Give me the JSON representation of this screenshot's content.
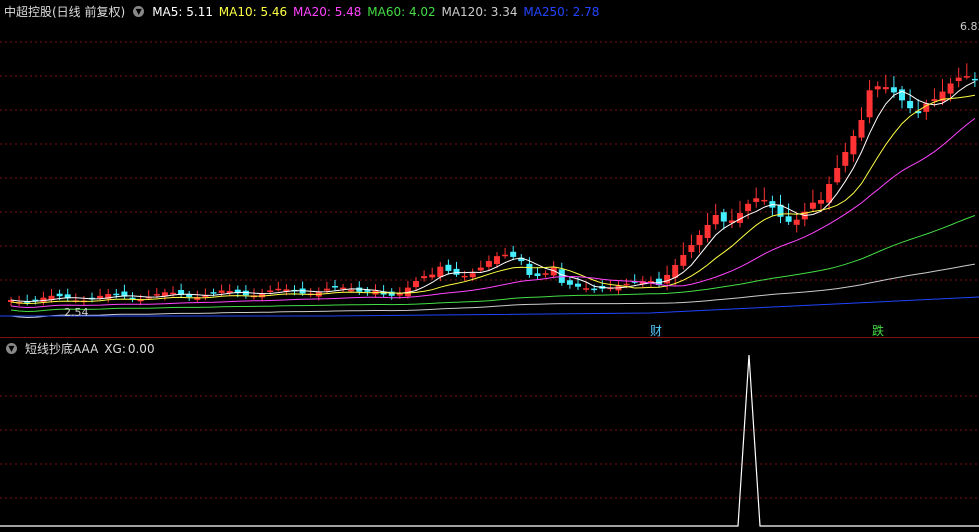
{
  "main": {
    "title": "中超控股(日线 前复权)",
    "ma": [
      {
        "label": "MA5:",
        "value": "5.11",
        "color": "#ffffff"
      },
      {
        "label": "MA10:",
        "value": "5.46",
        "color": "#ffff44"
      },
      {
        "label": "MA20:",
        "value": "5.48",
        "color": "#ff44ff"
      },
      {
        "label": "MA60:",
        "value": "4.02",
        "color": "#44dd44"
      },
      {
        "label": "MA120:",
        "value": "3.34",
        "color": "#cccccc"
      },
      {
        "label": "MA250:",
        "value": "2.78",
        "color": "#2244ff"
      }
    ],
    "high_label": "6.83",
    "low_label": "2.54",
    "tag_cai": "财",
    "tag_die": "跌"
  },
  "indicator": {
    "name": "短线抄底AAA",
    "xg_label": "XG:",
    "xg_value": "0.00"
  },
  "colors": {
    "up": "#ff3333",
    "down": "#44eeff",
    "grid": "#7a1212",
    "ma5": "#ffffff",
    "ma10": "#ffff44",
    "ma20": "#ff44ff",
    "ma60": "#44dd44",
    "ma120": "#cccccc",
    "ma250": "#2244ff"
  }
}
